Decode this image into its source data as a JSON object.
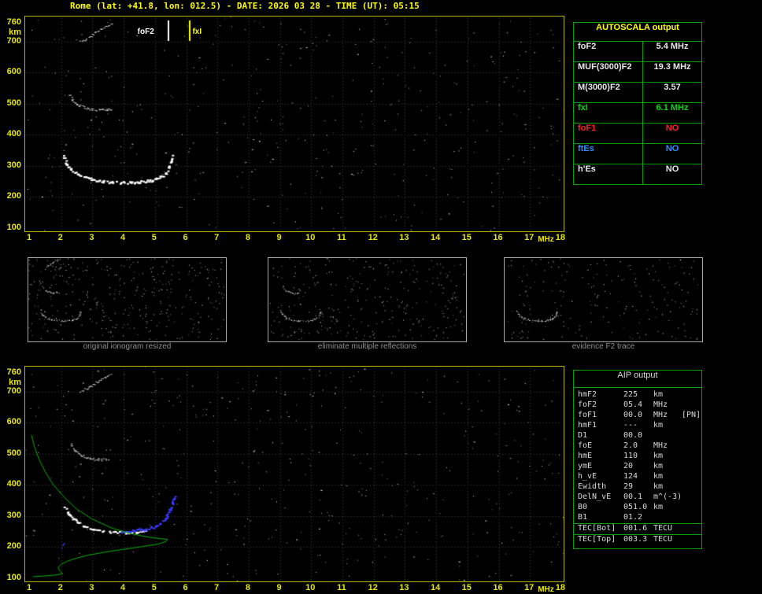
{
  "header": {
    "title": "Rome (lat: +41.8, lon: 012.5) - DATE: 2026 03 28 - TIME (UT): 05:15"
  },
  "autoscala": {
    "title": "AUTOSCALA output",
    "rows": [
      {
        "label": "foF2",
        "value": "5.4 MHz",
        "color": "#e8e8e8"
      },
      {
        "label": "MUF(3000)F2",
        "value": "19.3 MHz",
        "color": "#e8e8e8"
      },
      {
        "label": "M(3000)F2",
        "value": "3.57",
        "color": "#e8e8e8"
      },
      {
        "label": "fxI",
        "value": "6.1 MHz",
        "color": "#00dd00"
      },
      {
        "label": "foF1",
        "value": "NO",
        "color": "#ff2222"
      },
      {
        "label": "ftEs",
        "value": "NO",
        "color": "#2a8fff"
      },
      {
        "label": "h'Es",
        "value": "NO",
        "color": "#e8e8e8"
      }
    ]
  },
  "aip": {
    "title": "AIP output",
    "rows": [
      {
        "name": "hmF2",
        "value": "225",
        "unit": "km"
      },
      {
        "name": "foF2",
        "value": "05.4",
        "unit": "MHz"
      },
      {
        "name": "foF1",
        "value": "00.0",
        "unit": "MHz",
        "extra": "[PN]"
      },
      {
        "name": "hmF1",
        "value": "---",
        "unit": "km"
      },
      {
        "name": "D1",
        "value": "00.0",
        "unit": ""
      },
      {
        "name": "foE",
        "value": "2.0",
        "unit": "MHz"
      },
      {
        "name": "hmE",
        "value": "110",
        "unit": "km"
      },
      {
        "name": "ymE",
        "value": "20",
        "unit": "km"
      },
      {
        "name": "h_vE",
        "value": "124",
        "unit": "km"
      },
      {
        "name": "Ewidth",
        "value": "29",
        "unit": "km"
      },
      {
        "name": "DelN_vE",
        "value": "00.1",
        "unit": "m^(-3)"
      },
      {
        "name": "B0",
        "value": "051.0",
        "unit": "km"
      },
      {
        "name": "B1",
        "value": "01.2",
        "unit": ""
      },
      {
        "name": "TEC[Bot]",
        "value": "001.6",
        "unit": "TECU",
        "divider": true
      },
      {
        "name": "TEC[Top]",
        "value": "003.3",
        "unit": "TECU",
        "divider": true
      }
    ]
  },
  "thumbnails": {
    "items": [
      {
        "caption": "original ionogram resized"
      },
      {
        "caption": "eliminate multiple reflections"
      },
      {
        "caption": "evidence F2 trace"
      }
    ]
  },
  "colors": {
    "axis": "#e8e800",
    "title": "#ffff00",
    "table_border": "#00a400",
    "trace_white": "#ffffff",
    "trace_blue": "#3b3bff",
    "profile_green": "#00b400",
    "fof1_red": "#ff2222",
    "ftes_blue": "#2a8fff"
  },
  "chart_data": [
    {
      "type": "scatter",
      "title": "recorded ionogram",
      "xlabel": "MHz",
      "ylabel": "km",
      "xlim": [
        1,
        18
      ],
      "ylim": [
        100,
        760
      ],
      "x_ticks": [
        1,
        2,
        3,
        4,
        5,
        6,
        7,
        8,
        9,
        10,
        11,
        12,
        13,
        14,
        15,
        16,
        17,
        18
      ],
      "y_ticks": [
        760,
        700,
        600,
        500,
        400,
        300,
        200,
        100
      ],
      "grid": true,
      "markers": [
        {
          "label": "foF2",
          "freq": 5.4,
          "color": "#ffffff",
          "label_side": "left"
        },
        {
          "label": "fxI",
          "freq": 6.1,
          "color": "#ffff00",
          "label_side": "right"
        }
      ],
      "noise": {
        "seed": 7,
        "count": 420
      },
      "traces": [
        {
          "name": "F2-trace",
          "color": "#ffffff",
          "thickness": 3,
          "points": [
            [
              2.05,
              332
            ],
            [
              2.15,
              308
            ],
            [
              2.3,
              290
            ],
            [
              2.5,
              275
            ],
            [
              2.75,
              264
            ],
            [
              3.0,
              257
            ],
            [
              3.3,
              252
            ],
            [
              3.6,
              249
            ],
            [
              3.9,
              248
            ],
            [
              4.2,
              248
            ],
            [
              4.5,
              250
            ],
            [
              4.8,
              254
            ],
            [
              5.0,
              259
            ],
            [
              5.2,
              267
            ],
            [
              5.32,
              278
            ],
            [
              5.42,
              295
            ],
            [
              5.5,
              315
            ],
            [
              5.55,
              332
            ]
          ]
        },
        {
          "name": "second-hop-trace",
          "color": "#e0e0e0",
          "thickness": 2,
          "points": [
            [
              2.25,
              532
            ],
            [
              2.35,
              512
            ],
            [
              2.5,
              498
            ],
            [
              2.7,
              489
            ],
            [
              2.95,
              483
            ],
            [
              3.2,
              480
            ],
            [
              3.45,
              480
            ],
            [
              3.6,
              483
            ]
          ]
        },
        {
          "name": "high-trace",
          "color": "#d0d0d0",
          "thickness": 2,
          "points": [
            [
              2.6,
              700
            ],
            [
              2.9,
              715
            ],
            [
              3.1,
              730
            ],
            [
              3.35,
              745
            ],
            [
              3.6,
              757
            ]
          ]
        }
      ]
    },
    {
      "type": "scatter",
      "title": "restored ionogram with electron density profile",
      "xlabel": "MHz",
      "ylabel": "km",
      "xlim": [
        1,
        18
      ],
      "ylim": [
        100,
        760
      ],
      "x_ticks": [
        1,
        2,
        3,
        4,
        5,
        6,
        7,
        8,
        9,
        10,
        11,
        12,
        13,
        14,
        15,
        16,
        17,
        18
      ],
      "y_ticks": [
        760,
        700,
        600,
        500,
        400,
        300,
        200,
        100
      ],
      "grid": true,
      "markers": [],
      "noise": {
        "seed": 21,
        "count": 420
      },
      "traces": [
        {
          "name": "F2-trace",
          "color": "#ffffff",
          "thickness": 3,
          "points": [
            [
              2.1,
              330
            ],
            [
              2.25,
              305
            ],
            [
              2.45,
              285
            ],
            [
              2.7,
              270
            ],
            [
              3.0,
              260
            ],
            [
              3.35,
              253
            ],
            [
              3.7,
              249
            ],
            [
              4.05,
              248
            ],
            [
              4.4,
              250
            ],
            [
              4.7,
              255
            ]
          ]
        },
        {
          "name": "restored-trace",
          "color": "#3b3bff",
          "thickness": 3,
          "points": [
            [
              3.9,
              252
            ],
            [
              4.3,
              255
            ],
            [
              4.7,
              260
            ],
            [
              5.0,
              268
            ],
            [
              5.2,
              280
            ],
            [
              5.35,
              298
            ],
            [
              5.45,
              320
            ],
            [
              5.55,
              345
            ],
            [
              5.6,
              365
            ]
          ]
        },
        {
          "name": "second-hop-trace",
          "color": "#e0e0e0",
          "thickness": 2,
          "points": [
            [
              2.3,
              530
            ],
            [
              2.45,
              508
            ],
            [
              2.65,
              494
            ],
            [
              2.9,
              486
            ],
            [
              3.2,
              482
            ],
            [
              3.5,
              481
            ]
          ]
        },
        {
          "name": "high-trace",
          "color": "#d0d0d0",
          "thickness": 2,
          "points": [
            [
              2.6,
              700
            ],
            [
              2.9,
              716
            ],
            [
              3.15,
              732
            ],
            [
              3.4,
              748
            ],
            [
              3.6,
              758
            ]
          ]
        },
        {
          "name": "es-blue-mark",
          "color": "#3b3bff",
          "thickness": 2,
          "points": [
            [
              2.0,
              200
            ],
            [
              2.1,
              212
            ]
          ]
        },
        {
          "name": "density-profile",
          "color": "#00b400",
          "thickness": 1,
          "style": "line",
          "points": [
            [
              1.05,
              560
            ],
            [
              1.15,
              520
            ],
            [
              1.3,
              480
            ],
            [
              1.5,
              440
            ],
            [
              1.75,
              400
            ],
            [
              2.1,
              360
            ],
            [
              2.5,
              322
            ],
            [
              3.0,
              290
            ],
            [
              3.6,
              262
            ],
            [
              4.2,
              244
            ],
            [
              4.8,
              232
            ],
            [
              5.2,
              227
            ],
            [
              5.4,
              225
            ],
            [
              5.35,
              218
            ],
            [
              5.1,
              210
            ],
            [
              4.6,
              202
            ],
            [
              4.0,
              193
            ],
            [
              3.4,
              184
            ],
            [
              2.9,
              175
            ],
            [
              2.5,
              165
            ],
            [
              2.2,
              155
            ],
            [
              2.0,
              145
            ],
            [
              1.9,
              135
            ],
            [
              1.95,
              124
            ],
            [
              2.05,
              115
            ],
            [
              1.8,
              110
            ],
            [
              1.4,
              107
            ],
            [
              1.1,
              105
            ]
          ]
        }
      ]
    }
  ]
}
